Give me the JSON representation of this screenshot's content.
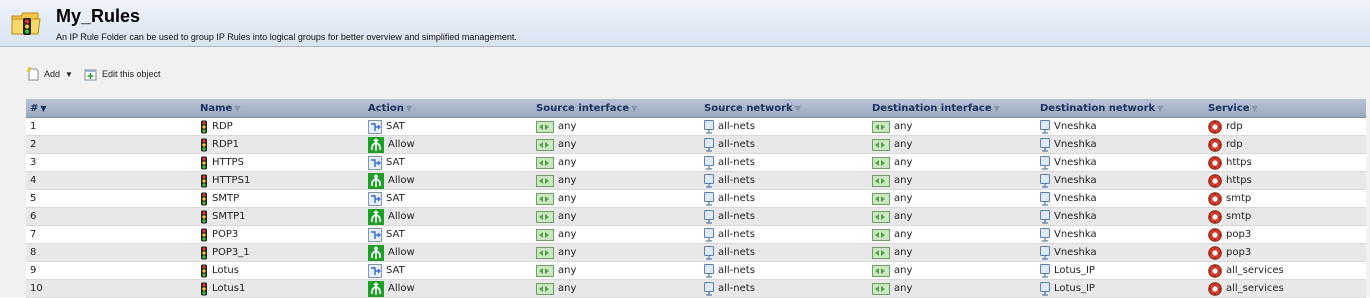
{
  "header": {
    "title": "My_Rules",
    "description": "An IP Rule Folder can be used to group IP Rules into logical groups for better overview and simplified management.",
    "icon": "folder-traffic-light-icon"
  },
  "toolbar": {
    "add_label": "Add",
    "edit_label": "Edit this object"
  },
  "table": {
    "sort_column": "#",
    "columns": [
      "#",
      "Name",
      "Action",
      "Source interface",
      "Source network",
      "Destination interface",
      "Destination network",
      "Service"
    ],
    "rows": [
      {
        "num": "1",
        "name": "RDP",
        "action": "SAT",
        "src_if": "any",
        "src_net": "all-nets",
        "dst_if": "any",
        "dst_net": "Vneshka",
        "service": "rdp"
      },
      {
        "num": "2",
        "name": "RDP1",
        "action": "Allow",
        "src_if": "any",
        "src_net": "all-nets",
        "dst_if": "any",
        "dst_net": "Vneshka",
        "service": "rdp"
      },
      {
        "num": "3",
        "name": "HTTPS",
        "action": "SAT",
        "src_if": "any",
        "src_net": "all-nets",
        "dst_if": "any",
        "dst_net": "Vneshka",
        "service": "https"
      },
      {
        "num": "4",
        "name": "HTTPS1",
        "action": "Allow",
        "src_if": "any",
        "src_net": "all-nets",
        "dst_if": "any",
        "dst_net": "Vneshka",
        "service": "https"
      },
      {
        "num": "5",
        "name": "SMTP",
        "action": "SAT",
        "src_if": "any",
        "src_net": "all-nets",
        "dst_if": "any",
        "dst_net": "Vneshka",
        "service": "smtp"
      },
      {
        "num": "6",
        "name": "SMTP1",
        "action": "Allow",
        "src_if": "any",
        "src_net": "all-nets",
        "dst_if": "any",
        "dst_net": "Vneshka",
        "service": "smtp"
      },
      {
        "num": "7",
        "name": "POP3",
        "action": "SAT",
        "src_if": "any",
        "src_net": "all-nets",
        "dst_if": "any",
        "dst_net": "Vneshka",
        "service": "pop3"
      },
      {
        "num": "8",
        "name": "POP3_1",
        "action": "Allow",
        "src_if": "any",
        "src_net": "all-nets",
        "dst_if": "any",
        "dst_net": "Vneshka",
        "service": "pop3"
      },
      {
        "num": "9",
        "name": "Lotus",
        "action": "SAT",
        "src_if": "any",
        "src_net": "all-nets",
        "dst_if": "any",
        "dst_net": "Lotus_IP",
        "service": "all_services"
      },
      {
        "num": "10",
        "name": "Lotus1",
        "action": "Allow",
        "src_if": "any",
        "src_net": "all-nets",
        "dst_if": "any",
        "dst_net": "Lotus_IP",
        "service": "all_services"
      }
    ]
  },
  "colors": {
    "header_bg": "#dde6f2",
    "table_header_bg": "#a8b5c9",
    "row_alt_bg": "#e8e8e8",
    "allow_green": "#1f9e2a",
    "service_red": "#d23c2a"
  }
}
